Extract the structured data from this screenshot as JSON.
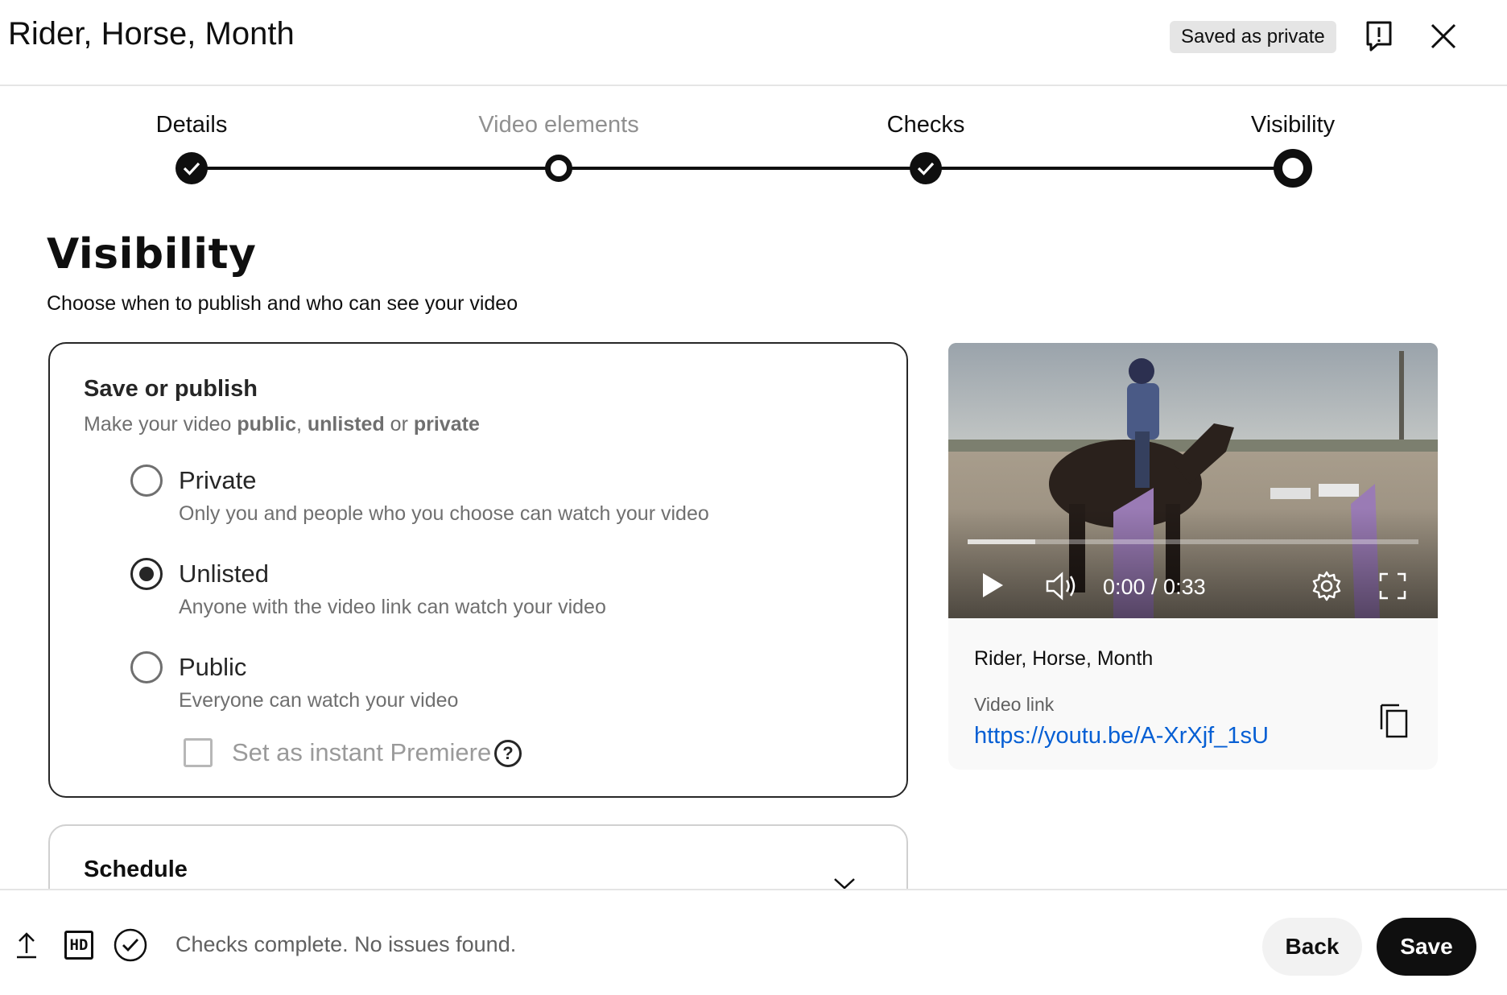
{
  "header": {
    "title": "Rider, Horse, Month",
    "badge": "Saved as private",
    "feedback_icon": "feedback-icon",
    "close_icon": "close-icon"
  },
  "stepper": {
    "steps": [
      {
        "label": "Details",
        "state": "done"
      },
      {
        "label": "Video elements",
        "state": "open"
      },
      {
        "label": "Checks",
        "state": "done"
      },
      {
        "label": "Visibility",
        "state": "current"
      }
    ]
  },
  "page": {
    "heading": "Visibility",
    "subtitle": "Choose when to publish and who can see your video"
  },
  "save_publish": {
    "title": "Save or publish",
    "sub_prefix": "Make your video ",
    "sub_public": "public",
    "sub_comma": ", ",
    "sub_unlisted": "unlisted",
    "sub_or": " or ",
    "sub_private": "private",
    "options": [
      {
        "label": "Private",
        "desc": "Only you and people who you choose can watch your video",
        "selected": false
      },
      {
        "label": "Unlisted",
        "desc": "Anyone with the video link can watch your video",
        "selected": true
      },
      {
        "label": "Public",
        "desc": "Everyone can watch your video",
        "selected": false
      }
    ],
    "premiere_label": "Set as instant Premiere",
    "premiere_checked": false,
    "help": "?"
  },
  "schedule": {
    "title": "Schedule"
  },
  "video": {
    "time": "0:00 / 0:33",
    "progress": 0.15,
    "title": "Rider, Horse, Month",
    "link_label": "Video link",
    "link": "https://youtu.be/A-XrXjf_1sU"
  },
  "footer": {
    "status": "Checks complete. No issues found.",
    "back_label": "Back",
    "save_label": "Save",
    "hd_badge": "HD"
  },
  "colors": {
    "accent_link": "#065fd4",
    "badge_bg": "#e5e5e5",
    "primary_button": "#0f0f0f"
  }
}
